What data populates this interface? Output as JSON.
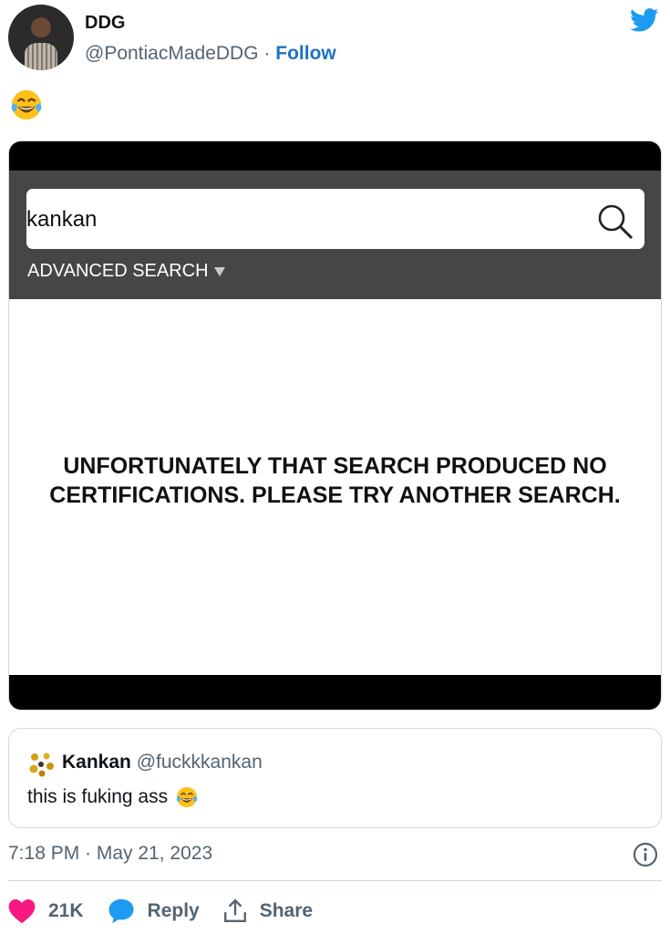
{
  "author": {
    "display_name": "DDG",
    "handle": "@PontiacMadeDDG",
    "separator": "·",
    "follow_label": "Follow"
  },
  "tweet": {
    "text_emoji": "face-with-tears-of-joy"
  },
  "media": {
    "search": {
      "value": "kankan",
      "advanced_label": "ADVANCED SEARCH"
    },
    "no_results_line1": "UNFORTUNATELY THAT SEARCH PRODUCED NO",
    "no_results_line2": "CERTIFICATIONS. PLEASE TRY ANOTHER SEARCH."
  },
  "quote": {
    "display_name": "Kankan",
    "handle": "@fuckkkankan",
    "text": "this is fuking ass"
  },
  "meta": {
    "timestamp": "7:18 PM · May 21, 2023"
  },
  "actions": {
    "like_count": "21K",
    "reply_label": "Reply",
    "share_label": "Share"
  },
  "colors": {
    "brand_blue": "#1d9bf0",
    "like_red": "#f91880",
    "link_blue": "#1d72c4",
    "secondary_text": "#536471"
  }
}
